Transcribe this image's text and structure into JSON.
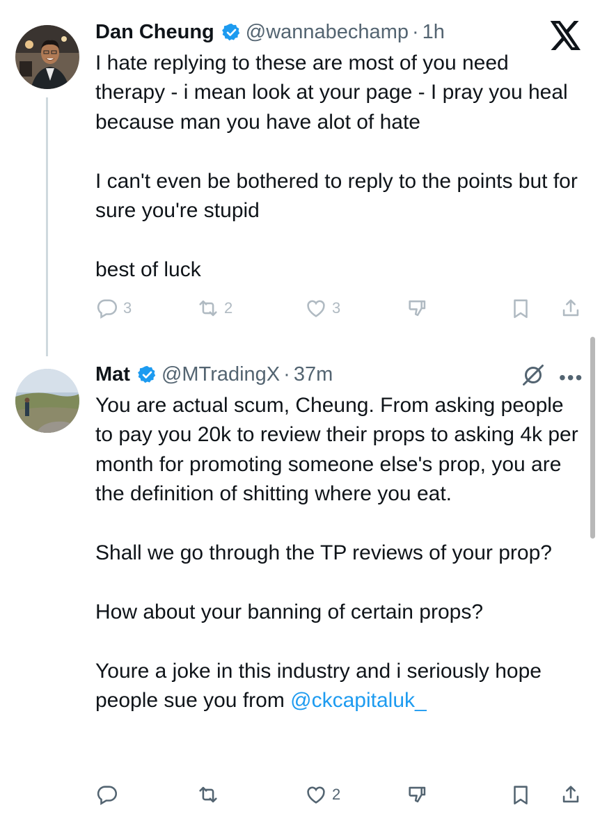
{
  "tweets": [
    {
      "name": "Dan Cheung",
      "handle": "@wannabechamp",
      "separator": "·",
      "time": "1h",
      "text": "I hate replying to these are most of you need therapy - i mean look at your page - I pray you heal because man you have alot of hate\n\nI can't even be bothered to reply to the points but for sure you're stupid\n\nbest of luck",
      "replies": "3",
      "reposts": "2",
      "likes": "3"
    },
    {
      "name": "Mat",
      "handle": "@MTradingX",
      "separator": "·",
      "time": "37m",
      "text": "You are actual scum, Cheung. From asking people to pay you 20k to review their props to asking 4k per month for promoting someone else's prop, you are the definition of shitting where you eat.\n\nShall we go through the TP reviews of your prop?\n\nHow about your banning of certain props?\n\nYoure a joke in this industry and i seriously hope people sue you from ",
      "mention": "@ckcapitaluk_",
      "replies": "",
      "reposts": "",
      "likes": "2"
    }
  ],
  "icons": [
    "x-logo-icon",
    "verified-icon",
    "reply-icon",
    "repost-icon",
    "like-icon",
    "dislike-icon",
    "bookmark-icon",
    "share-icon",
    "grok-icon",
    "more-icon"
  ],
  "colors": {
    "accent": "#1d9bf0",
    "secondary_text": "#536471",
    "faded_icon": "#b0bac2",
    "thread_line": "#cfd9de"
  }
}
